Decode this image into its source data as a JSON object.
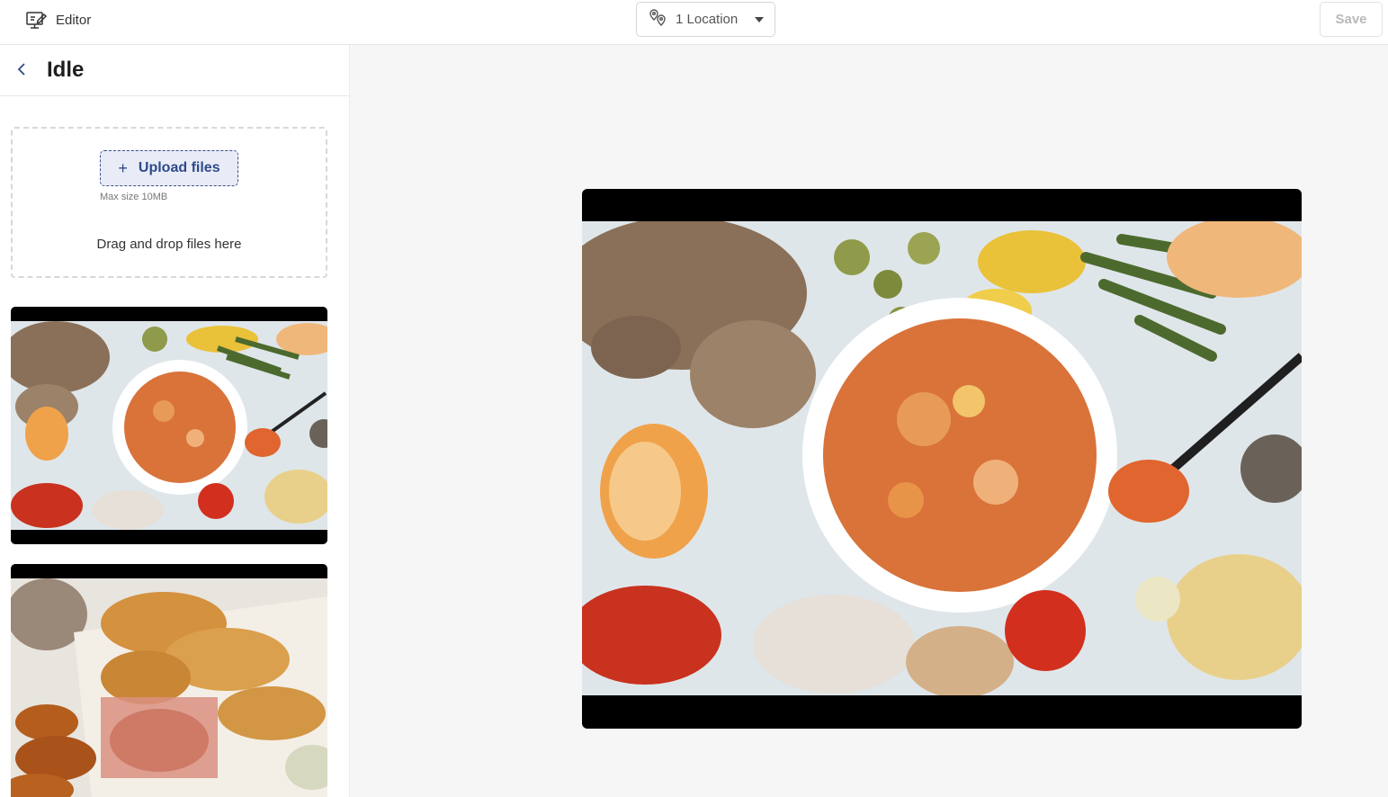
{
  "topbar": {
    "editor_label": "Editor",
    "location_label": "1 Location",
    "save_label": "Save"
  },
  "sidebar": {
    "title": "Idle",
    "upload": {
      "button_label": "Upload files",
      "max_size": "Max size 10MB",
      "drag_drop_text": "Drag and drop files here"
    },
    "media_items": [
      {
        "name": "bbq-bowl-thumbnail"
      },
      {
        "name": "fried-chicken-thumbnail"
      }
    ]
  },
  "colors": {
    "accent": "#2f4a8a",
    "upload_bg": "#e9ecf7",
    "canvas_bg": "#f6f6f6"
  },
  "icons": [
    "editor-icon",
    "location-pin-icon",
    "chevron-down-icon",
    "back-chevron-icon",
    "plus-icon"
  ]
}
